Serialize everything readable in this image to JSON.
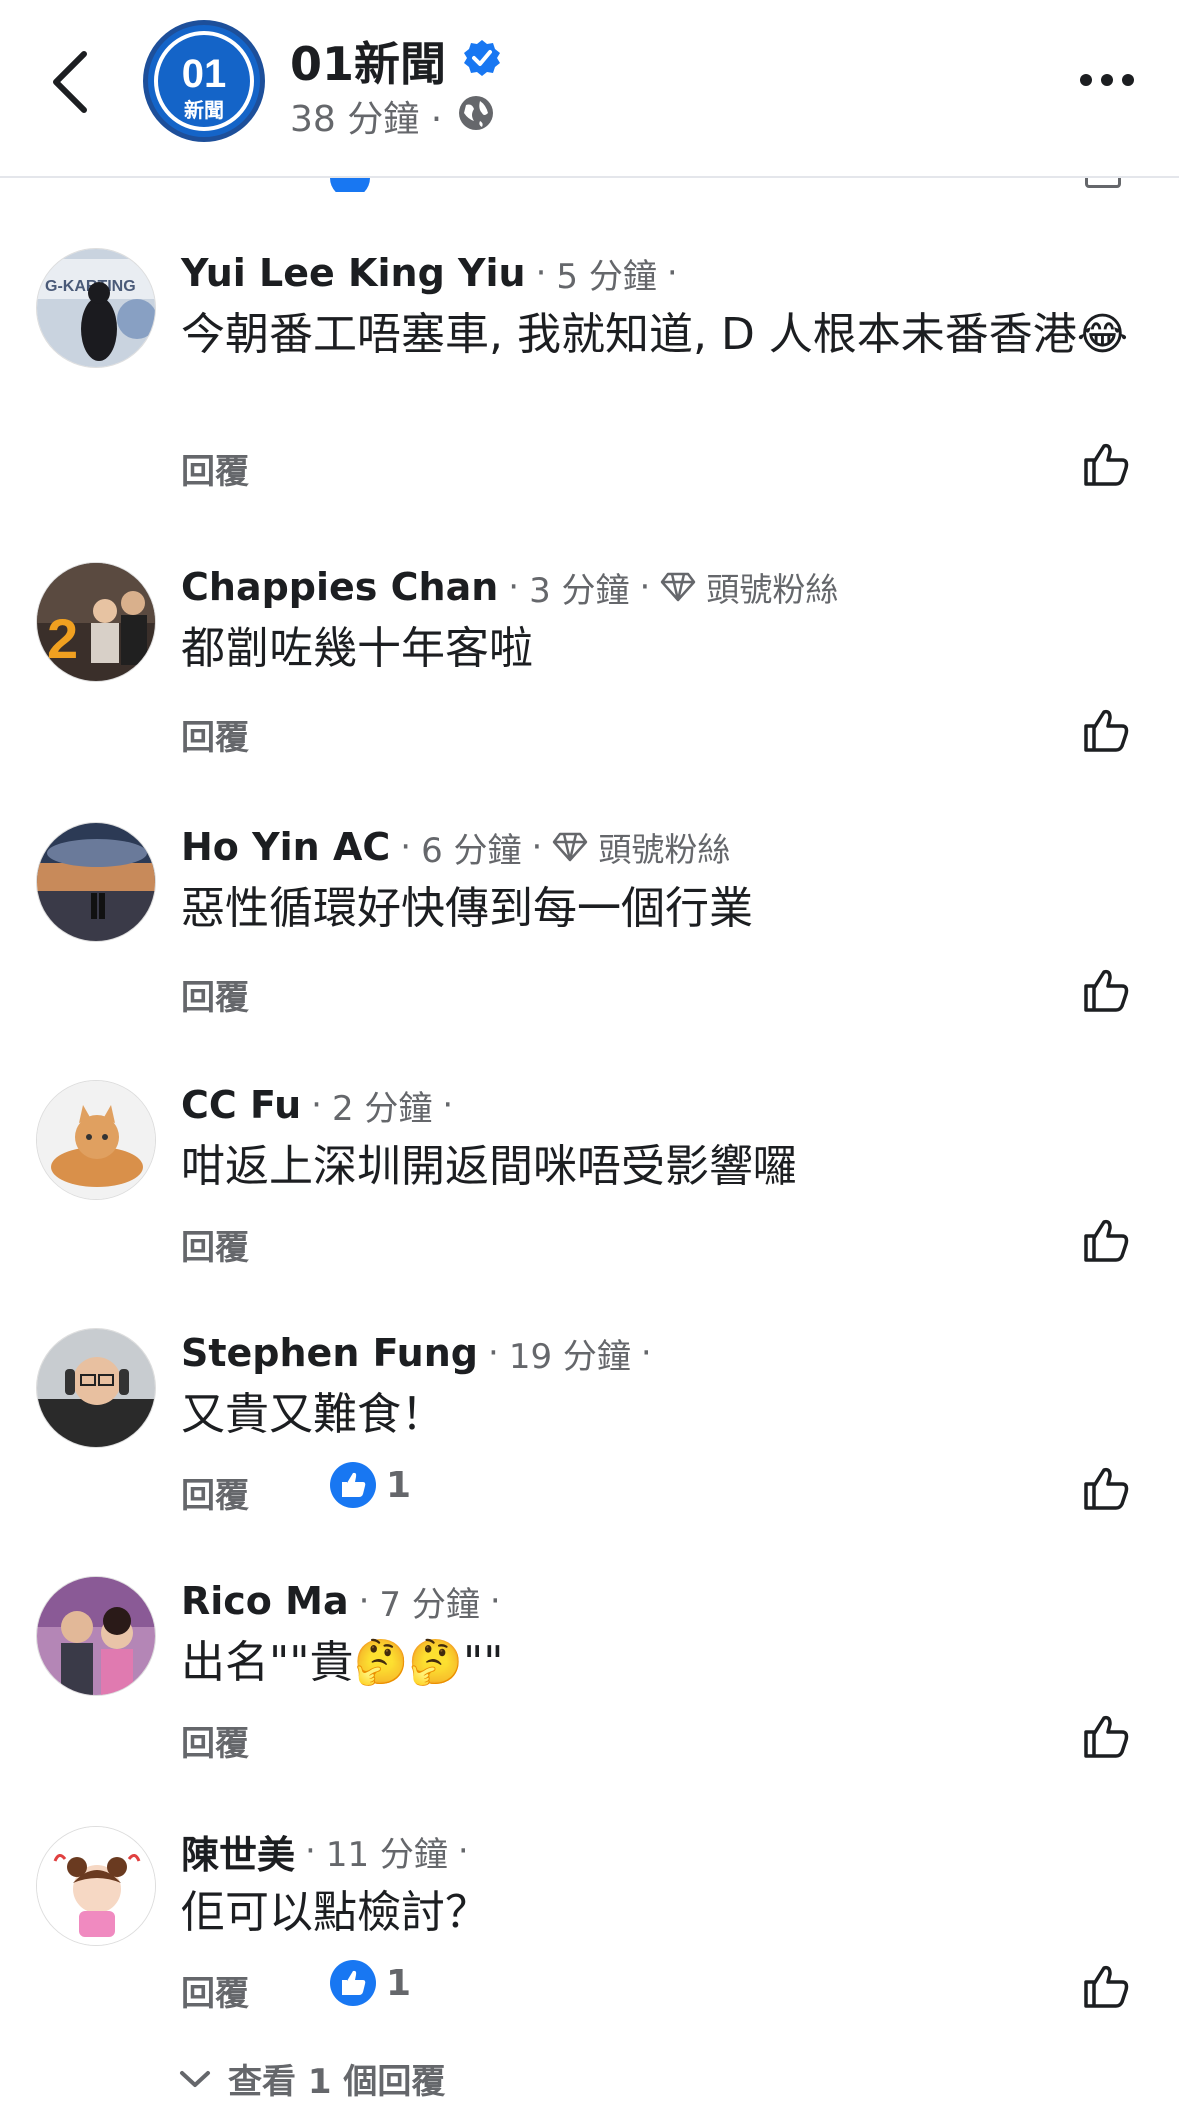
{
  "header": {
    "back_icon": "back-chevron-icon",
    "page_name": "01新聞",
    "logo_text": "01",
    "logo_sub": "新聞",
    "post_time": "38 分鐘 ·",
    "verified_icon": "verified-badge-icon",
    "audience_icon": "globe-icon",
    "more_icon": "more-options-icon"
  },
  "comments": [
    {
      "name": "Yui Lee King Yiu",
      "time": "5 分鐘",
      "badge": "",
      "text": "今朝番工唔塞車, 我就知道, D 人根本未番香港😂",
      "reply": "回覆",
      "likes": ""
    },
    {
      "name": "Chappies Chan",
      "time": "3 分鐘",
      "badge": "頭號粉絲",
      "text": "都劏咗幾十年客啦",
      "reply": "回覆",
      "likes": ""
    },
    {
      "name": "Ho Yin AC",
      "time": "6 分鐘",
      "badge": "頭號粉絲",
      "text": "惡性循環好快傳到每一個行業",
      "reply": "回覆",
      "likes": ""
    },
    {
      "name": "CC Fu",
      "time": "2 分鐘",
      "badge": "",
      "text": "咁返上深圳開返間咪唔受影響囉",
      "reply": "回覆",
      "likes": ""
    },
    {
      "name": "Stephen Fung",
      "time": "19 分鐘",
      "badge": "",
      "text": "又貴又難食！",
      "reply": "回覆",
      "likes": "1"
    },
    {
      "name": "Rico Ma",
      "time": "7 分鐘",
      "badge": "",
      "text": "出名\"\"貴🤔🤔\"\"",
      "reply": "回覆",
      "likes": ""
    },
    {
      "name": "陳世美",
      "time": "11 分鐘",
      "badge": "",
      "text": "佢可以點檢討？",
      "reply": "回覆",
      "likes": "1"
    }
  ],
  "view_replies": "查看 1 個回覆",
  "colors": {
    "brand_blue": "#1877f2",
    "secondary_text": "#65676b",
    "primary_text": "#1c1e21"
  }
}
